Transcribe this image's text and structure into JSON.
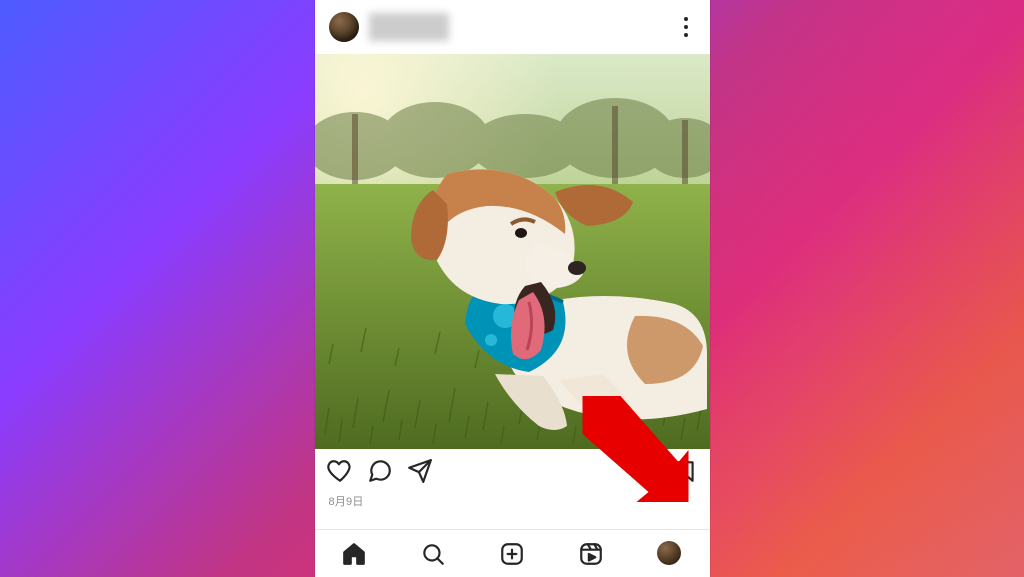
{
  "post": {
    "username": "",
    "date": "8月9日",
    "image_alt": "A happy dog with a blue bandana lying on grass in a sunny park"
  },
  "icons": {
    "more_menu": "more-options",
    "like": "heart",
    "comment": "speech-bubble",
    "share": "paper-plane",
    "save": "bookmark",
    "nav_home": "home",
    "nav_search": "search",
    "nav_create": "add-post",
    "nav_reels": "reels",
    "nav_profile": "profile-avatar"
  },
  "annotation": {
    "arrow_target": "save-button",
    "arrow_color": "#e60000"
  }
}
